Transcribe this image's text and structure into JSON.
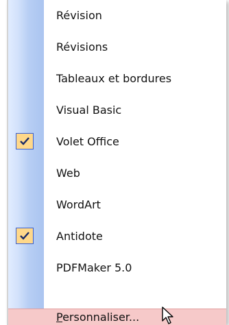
{
  "menu": {
    "items": [
      {
        "label": "Révision",
        "checked": false
      },
      {
        "label": "Révisions",
        "checked": false
      },
      {
        "label": "Tableaux et bordures",
        "checked": false
      },
      {
        "label": "Visual Basic",
        "checked": false
      },
      {
        "label": "Volet Office",
        "checked": true
      },
      {
        "label": "Web",
        "checked": false
      },
      {
        "label": "WordArt",
        "checked": false
      },
      {
        "label": "Antidote",
        "checked": true
      },
      {
        "label": "PDFMaker 5.0",
        "checked": false
      }
    ],
    "customize": {
      "first_letter": "P",
      "rest": "ersonnaliser..."
    }
  },
  "colors": {
    "check_bg": "#ffd88a",
    "check_border": "#3a5fcd",
    "highlight_bg": "#f6c9c9",
    "gutter": "#b7cef4"
  },
  "icons": [
    "checkmark-icon",
    "mouse-cursor-icon"
  ]
}
